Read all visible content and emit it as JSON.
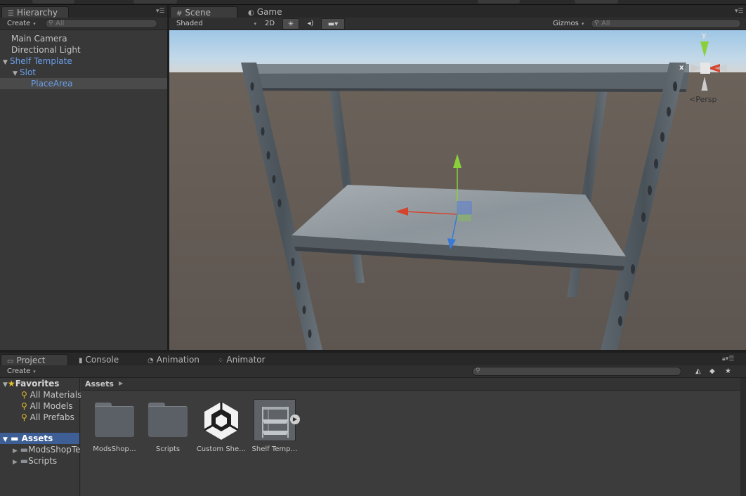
{
  "hierarchy": {
    "tab": "Hierarchy",
    "create": "Create",
    "search_placeholder": "All",
    "items": [
      {
        "label": "Main Camera"
      },
      {
        "label": "Directional Light"
      },
      {
        "label": "Shelf Template"
      },
      {
        "label": "Slot"
      },
      {
        "label": "PlaceArea"
      }
    ]
  },
  "scene": {
    "tabs": [
      {
        "label": "Scene"
      },
      {
        "label": "Game"
      }
    ],
    "shading": "Shaded",
    "mode_2d": "2D",
    "gizmos": "Gizmos",
    "search_placeholder": "All",
    "persp": "Persp",
    "axis_y": "y",
    "axis_x": "x"
  },
  "project": {
    "tabs": [
      {
        "label": "Project"
      },
      {
        "label": "Console"
      },
      {
        "label": "Animation"
      },
      {
        "label": "Animator"
      }
    ],
    "create": "Create",
    "favorites": "Favorites",
    "favorite_items": [
      {
        "label": "All Materials"
      },
      {
        "label": "All Models"
      },
      {
        "label": "All Prefabs"
      }
    ],
    "assets_root": "Assets",
    "asset_folders": [
      {
        "label": "ModsShopTe"
      },
      {
        "label": "Scripts"
      }
    ],
    "breadcrumb": "Assets",
    "assets": [
      {
        "label": "ModsShop…"
      },
      {
        "label": "Scripts"
      },
      {
        "label": "Custom She…"
      },
      {
        "label": "Shelf Temp…"
      }
    ]
  },
  "colors": {
    "selection": "#3e5f96",
    "prefab_text": "#6b9ee8",
    "panel": "#383838"
  }
}
